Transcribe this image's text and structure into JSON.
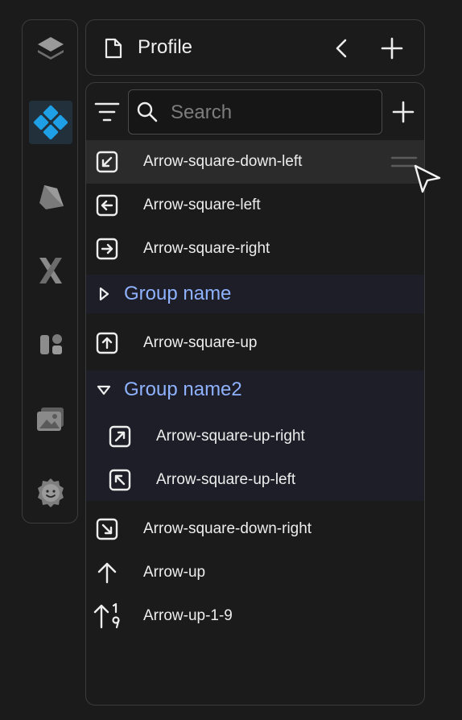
{
  "header": {
    "title": "Profile",
    "icons": [
      "file-icon",
      "chevron-left-icon",
      "plus-icon"
    ]
  },
  "rail": {
    "items": [
      {
        "icon": "layers-icon"
      },
      {
        "icon": "diamond-grid-icon",
        "active": true
      },
      {
        "icon": "box-icon"
      },
      {
        "icon": "x-icon"
      },
      {
        "icon": "components-icon"
      },
      {
        "icon": "images-icon"
      },
      {
        "icon": "settings-gear-icon"
      }
    ]
  },
  "toolbar": {
    "search_placeholder": "Search",
    "icons": [
      "filter-icon",
      "search-icon",
      "plus-icon"
    ]
  },
  "list": {
    "items": [
      {
        "label": "Arrow-square-down-left",
        "icon": "arrow-square-down-left-icon",
        "hovered": true
      },
      {
        "label": "Arrow-square-left",
        "icon": "arrow-square-left-icon"
      },
      {
        "label": "Arrow-square-right",
        "icon": "arrow-square-right-icon"
      },
      {
        "label": "Group name",
        "group": true,
        "expanded": false
      },
      {
        "label": "Arrow-square-up",
        "icon": "arrow-square-up-icon"
      },
      {
        "label": "Group name2",
        "group": true,
        "expanded": true
      },
      {
        "label": "Arrow-square-up-right",
        "icon": "arrow-square-up-right-icon",
        "child": true
      },
      {
        "label": "Arrow-square-up-left",
        "icon": "arrow-square-up-left-icon",
        "child": true
      },
      {
        "label": "Arrow-square-down-right",
        "icon": "arrow-square-down-right-icon"
      },
      {
        "label": "Arrow-up",
        "icon": "arrow-up-icon"
      },
      {
        "label": "Arrow-up-1-9",
        "icon": "arrow-up-1-9-icon"
      }
    ]
  },
  "colors": {
    "background": "#1b1b1b",
    "border": "#3c3c3c",
    "group_text": "#8fb2ff",
    "group_bg": "#1d1e27",
    "accent_blue": "#1e9fe6"
  }
}
